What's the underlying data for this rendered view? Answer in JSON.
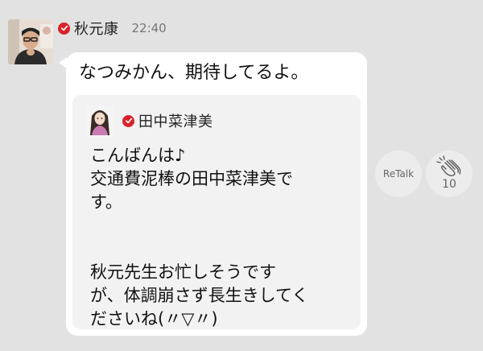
{
  "post": {
    "sender_name": "秋元康",
    "timestamp": "22:40",
    "message": "なつみかん、期待してるよ。"
  },
  "quoted": {
    "sender_name": "田中菜津美",
    "lines": [
      "こんばんは♪",
      "交通費泥棒の田中菜津美で",
      "す。",
      "",
      "",
      "秋元先生お忙しそうです",
      "が、体調崩さず長生きしてく",
      "ださいね(〃▽〃)"
    ]
  },
  "actions": {
    "retalk_label": "ReTalk",
    "clap_count": "10"
  },
  "colors": {
    "background": "#e2e2e2",
    "bubble": "#ffffff",
    "quote_card": "#f2f2f2",
    "verified_badge": "#d8232a"
  },
  "icons": {
    "verified": "verified-check-icon",
    "clap": "clap-icon"
  }
}
